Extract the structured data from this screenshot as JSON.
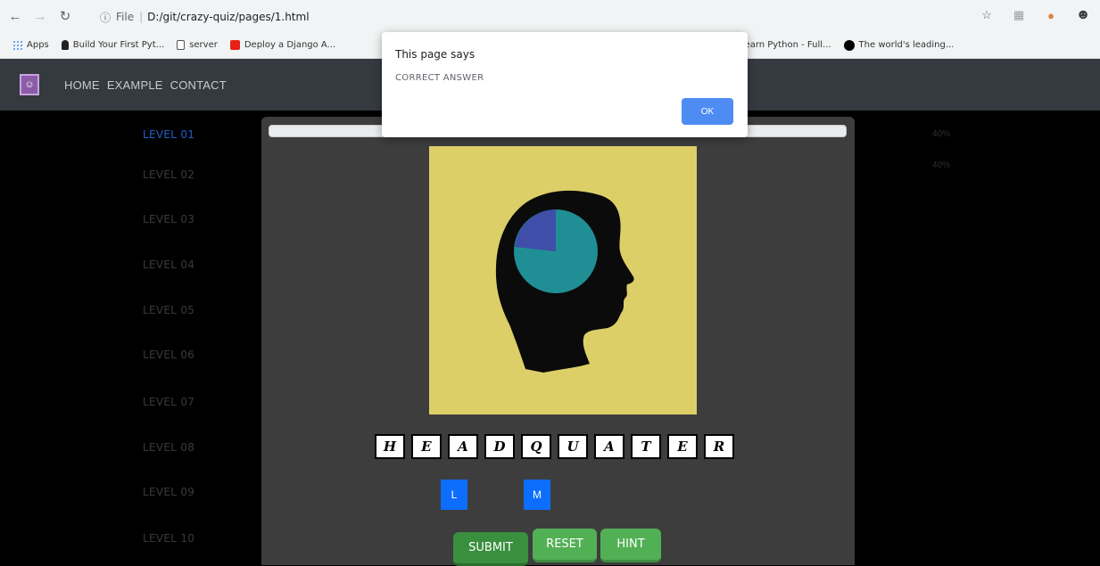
{
  "browser": {
    "url": "D:/git/crazy-quiz/pages/1.html",
    "scheme_label": "File",
    "bookmarks": [
      {
        "label": "Apps",
        "color": "#4285f4"
      },
      {
        "label": "Build Your First Pyt...",
        "color": "#222222"
      },
      {
        "label": "server",
        "color": "#ffffff"
      },
      {
        "label": "Deploy a Django A...",
        "color": "#e62117"
      },
      {
        "label": "Learn Python - Full...",
        "color": "#e62117"
      },
      {
        "label": "The world's leading...",
        "color": "#000000"
      }
    ]
  },
  "nav": {
    "items": [
      "HOME",
      "EXAMPLE",
      "CONTACT"
    ]
  },
  "sidebar": {
    "levels": [
      "LEVEL 01",
      "LEVEL 02",
      "LEVEL 03",
      "LEVEL 04",
      "LEVEL 05",
      "LEVEL 06",
      "LEVEL 07",
      "LEVEL 08",
      "LEVEL 09",
      "LEVEL 10"
    ],
    "active_index": 0
  },
  "right_col": [
    "40%",
    "40%"
  ],
  "quiz": {
    "letters": [
      "H",
      "E",
      "A",
      "D",
      "Q",
      "U",
      "A",
      "T",
      "E",
      "R"
    ],
    "answer_slots": [
      "L",
      "M"
    ],
    "buttons": {
      "submit": "SUBMIT",
      "reset": "RESET",
      "hint": "HINT"
    }
  },
  "dialog": {
    "title": "This page says",
    "message": "CORRECT ANSWER",
    "ok": "OK"
  },
  "colors": {
    "accent_blue": "#0d6efd",
    "button_green": "#52b054",
    "image_bg": "#ddcf68",
    "pie_main": "#1f8f95",
    "pie_slice": "#3f4ea8"
  }
}
